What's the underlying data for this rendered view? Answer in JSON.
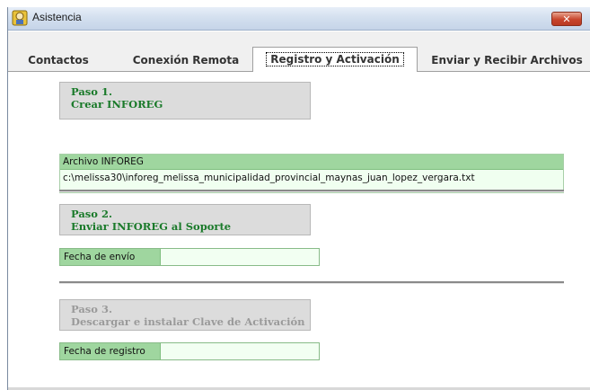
{
  "window": {
    "title": "Asistencia",
    "close_label": "✕"
  },
  "tabs": [
    {
      "label": "Contactos"
    },
    {
      "label": "Conexión Remota"
    },
    {
      "label": "Registro y Activación"
    },
    {
      "label": "Enviar y Recibir Archivos"
    }
  ],
  "active_tab_index": 2,
  "step1": {
    "line1": "Paso 1.",
    "line2": "Crear INFOREG"
  },
  "archivo": {
    "label": "Archivo INFOREG",
    "value": "c:\\melissa30\\inforeg_melissa_municipalidad_provincial_maynas_juan_lopez_vergara.txt"
  },
  "step2": {
    "line1": "Paso 2.",
    "line2": "Enviar INFOREG al Soporte"
  },
  "fecha_envio": {
    "label": "Fecha de envío",
    "value": ""
  },
  "step3": {
    "line1": "Paso 3.",
    "line2": "Descargar e instalar Clave de Activación"
  },
  "fecha_registro": {
    "label": "Fecha de registro",
    "value": ""
  },
  "colors": {
    "step_text": "#1a7a2a",
    "step_disabled_text": "#9a9a9a",
    "field_label_bg": "#9fd69f"
  }
}
